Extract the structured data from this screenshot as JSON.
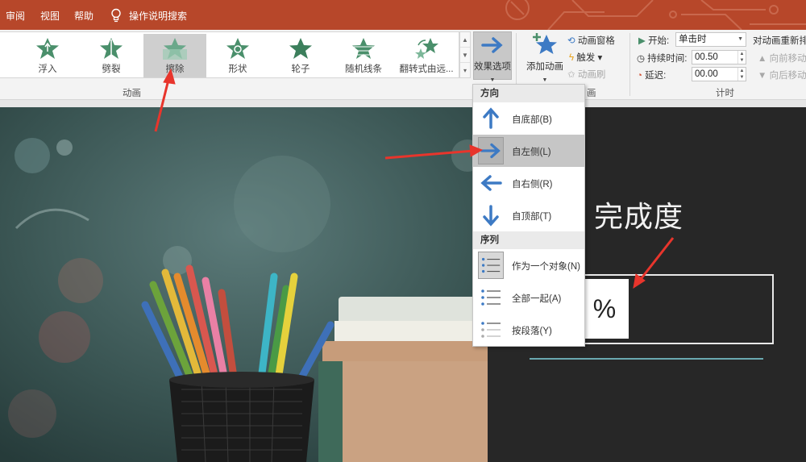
{
  "tabs": [
    "审阅",
    "视图",
    "帮助"
  ],
  "tell_me": "操作说明搜索",
  "gallery": {
    "items": [
      {
        "label": "浮入"
      },
      {
        "label": "劈裂"
      },
      {
        "label": "擦除",
        "selected": true
      },
      {
        "label": "形状"
      },
      {
        "label": "轮子"
      },
      {
        "label": "随机线条"
      },
      {
        "label": "翻转式由远..."
      }
    ],
    "group_label": "动画"
  },
  "effect_options": {
    "label": "效果选项"
  },
  "advanced": {
    "add_animation": "添加动画",
    "animation_pane": "动画窗格",
    "trigger": "触发",
    "animation_painter": "动画刷",
    "group_label_tail": "画"
  },
  "timing": {
    "start_label": "开始:",
    "start_value": "单击时",
    "duration_label": "持续时间:",
    "duration_value": "00.50",
    "delay_label": "延迟:",
    "delay_value": "00.00",
    "reorder_label": "对动画重新排",
    "move_earlier": "向前移动",
    "move_later": "向后移动",
    "group_label": "计时"
  },
  "dropdown": {
    "direction_header": "方向",
    "directions": [
      {
        "label": "自底部(B)",
        "icon": "arrow-up-icon"
      },
      {
        "label": "自左侧(L)",
        "icon": "arrow-right-icon",
        "highlighted": true
      },
      {
        "label": "自右侧(R)",
        "icon": "arrow-left-icon"
      },
      {
        "label": "自顶部(T)",
        "icon": "arrow-down-icon"
      }
    ],
    "sequence_header": "序列",
    "sequences": [
      {
        "label": "作为一个对象(N)",
        "selected": true
      },
      {
        "label": "全部一起(A)"
      },
      {
        "label": "按段落(Y)"
      }
    ]
  },
  "slide": {
    "title": "完成度",
    "percent": "%"
  },
  "colors": {
    "accent": "#b7472a",
    "arrow_blue": "#3d7ac4",
    "star_green": "#4a8f6b",
    "annotation_red": "#e8352c"
  }
}
